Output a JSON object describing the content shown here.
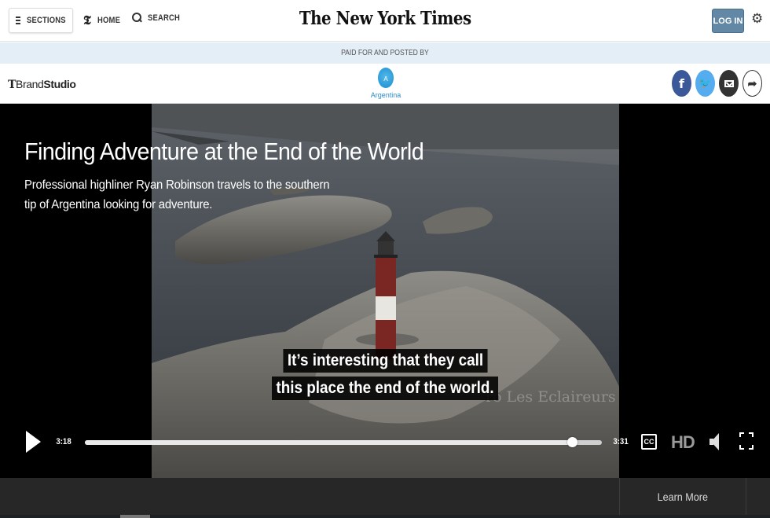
{
  "header": {
    "sections_label": "SECTIONS",
    "home_label": "HOME",
    "search_label": "SEARCH",
    "logo_text": "The New York Times",
    "login_label": "LOG IN",
    "home_icon_glyph": "𝕿",
    "gear_glyph": "⚙"
  },
  "sponsor_bar": {
    "paid_text": "PAID FOR AND POSTED BY"
  },
  "brand_bar": {
    "brand_prefix": "T",
    "brand_light": "Brand",
    "brand_bold": "Studio",
    "sponsor_mark": "A",
    "sponsor_name": "Argentina",
    "share_buttons": [
      {
        "name": "facebook-share-button",
        "icon": "facebook-icon",
        "glyph": "f",
        "color": "#3b5998"
      },
      {
        "name": "twitter-share-button",
        "icon": "twitter-icon",
        "glyph": "🐦",
        "color": "#55acee"
      },
      {
        "name": "email-share-button",
        "icon": "email-icon",
        "glyph": "",
        "color": "#333333"
      },
      {
        "name": "more-share-button",
        "icon": "share-arrow-icon",
        "glyph": "➦",
        "color": "#ffffff"
      }
    ]
  },
  "video": {
    "title": "Finding Adventure at the End of the World",
    "subtitle": "Professional highliner Ryan Robinson travels to the southern tip of Argentina looking for adventure.",
    "watermark": "ro Les Eclaireurs",
    "caption_line1": "It’s interesting that they call",
    "caption_line2": "this place the end of the world.",
    "current_time": "3:18",
    "duration": "3:31",
    "progress": 0.943,
    "cc_label": "CC",
    "hd_label": "HD"
  },
  "footer": {
    "learn_more": "Learn More"
  },
  "colors": {
    "login_blue": "#6288a5",
    "paid_bar_bg": "#e3eef7",
    "sponsor_blue": "#2b8dcc"
  }
}
